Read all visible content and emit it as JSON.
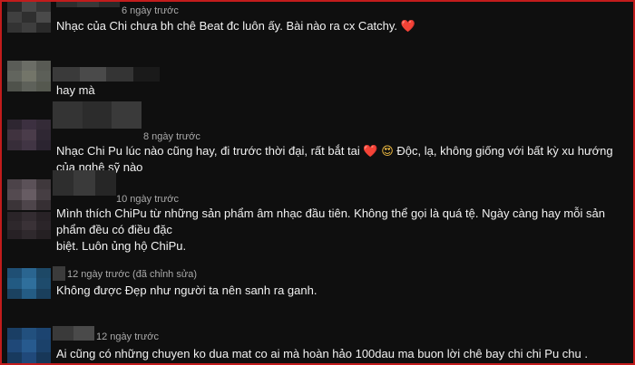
{
  "comments": [
    {
      "time": "6 ngày trước",
      "text": "Nhạc của Chi chưa bh chê Beat đc luôn ấy. Bài nào ra cx Catchy.",
      "emoji": "❤️"
    },
    {
      "time": "",
      "text": "hay mà"
    },
    {
      "time": "8 ngày trước",
      "text_part1": "Nhạc Chi Pu lúc nào cũng hay, đi trước thời đại, rất bắt tai",
      "emoji1": "❤️",
      "emoji2": "😍",
      "text_part2": "Độc, lạ, không giống với bất kỳ xu hướng của nghệ sỹ nào"
    },
    {
      "time": "10 ngày trước",
      "line1": "Mình thích ChiPu từ những sản phẩm âm nhạc đầu tiên. Không thể gọi là quá tệ. Ngày càng hay mỗi sản phẩm đều có điều đặc",
      "line2": "biệt. Luôn ủng hộ ChiPu."
    },
    {
      "time": "12 ngày trước (đã chỉnh sửa)",
      "text": "Không được Đẹp như người ta nên sanh ra ganh."
    },
    {
      "time": "12 ngày trước",
      "text": "Ai cũng có những chuyen ko dua mat co ai mà hoàn hảo 100dau ma buon lời chê bay chi  chi Pu chu ."
    }
  ],
  "colors": {
    "frame_border": "#c21c1c",
    "background": "#0f0f0f",
    "text": "#f1f1f1",
    "meta": "#aaaaaa",
    "heart": "#e2263a"
  }
}
